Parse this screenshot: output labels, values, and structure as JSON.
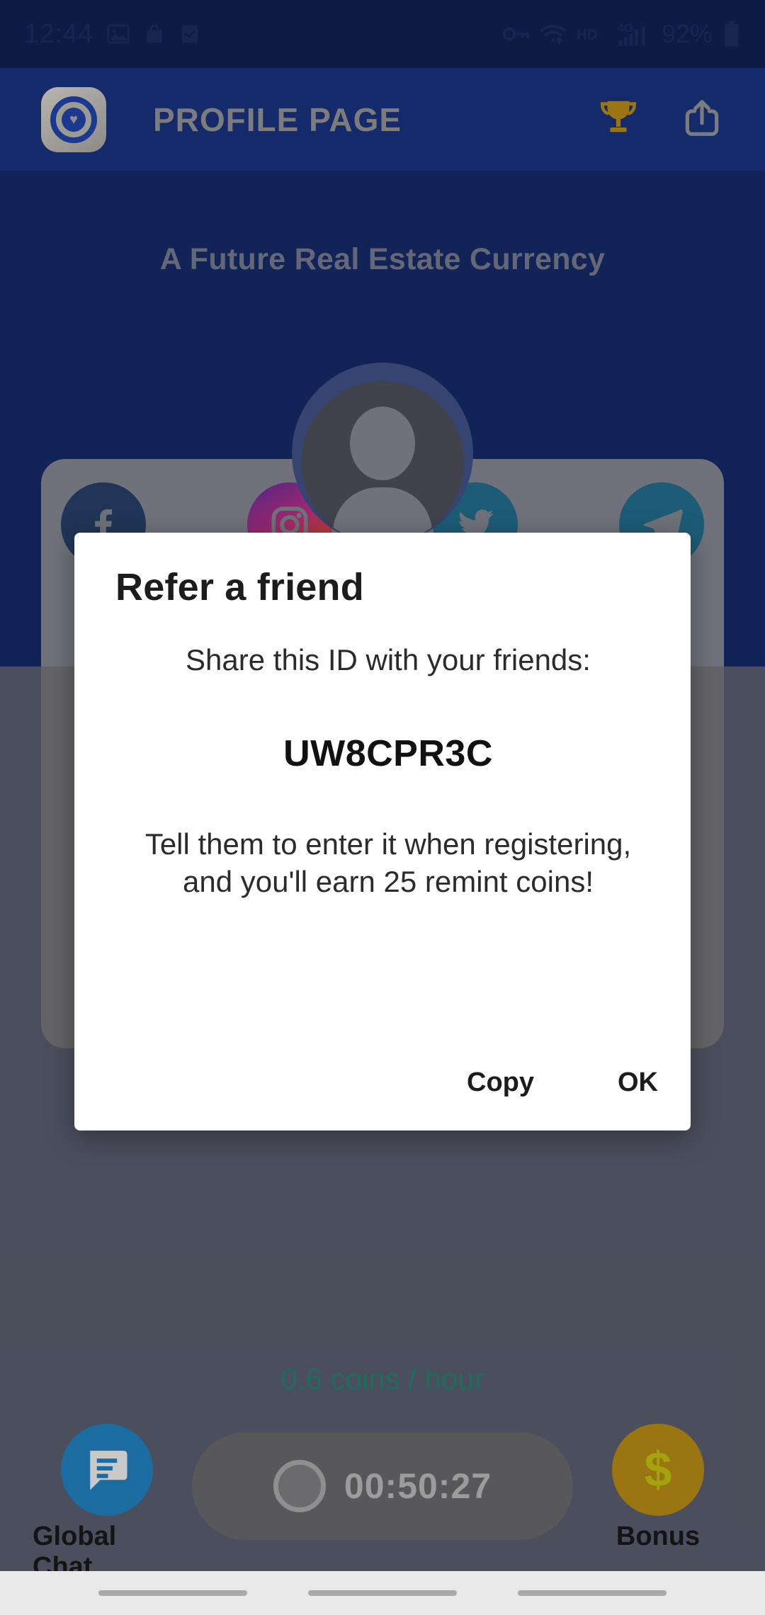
{
  "status_bar": {
    "time": "12:44",
    "left_icons": [
      "image-icon",
      "shopping-bag-icon",
      "checkbox-icon"
    ],
    "right_icons": [
      "vpn-key-icon",
      "wifi-icon",
      "hd-icon",
      "4g-signal-icon"
    ],
    "hd_label": "HD",
    "network_label": "4G",
    "battery_percent": "92%",
    "battery_icon": "battery-full-icon"
  },
  "app_bar": {
    "logo_icon": "app-logo-icon",
    "title": "PROFILE PAGE",
    "trophy_icon": "trophy-icon",
    "share_icon": "share-icon"
  },
  "page": {
    "tagline": "A Future Real Estate Currency",
    "avatar_icon": "avatar-placeholder-icon",
    "social": [
      {
        "name": "facebook-icon",
        "glyph": "f"
      },
      {
        "name": "instagram-icon",
        "glyph": ""
      },
      {
        "name": "twitter-icon",
        "glyph": ""
      },
      {
        "name": "telegram-icon",
        "glyph": ""
      }
    ]
  },
  "dialog": {
    "title": "Refer a friend",
    "subtitle": "Share this ID with your friends:",
    "referral_code": "UW8CPR3C",
    "body": "Tell them to enter it when registering, and you'll earn 25 remint coins!",
    "copy_label": "Copy",
    "ok_label": "OK"
  },
  "bottom": {
    "rate_text": "0.6 coins / hour",
    "chat_icon": "chat-bubble-icon",
    "chat_label": "Global Chat",
    "timer_icon": "record-circle-icon",
    "timer_value": "00:50:27",
    "bonus_icon": "dollar-sign-icon",
    "bonus_label": "Bonus"
  },
  "colors": {
    "status_bar_bg": "#0c1c45",
    "app_bar_bg": "#152a6b",
    "page_bg": "#12255e",
    "trophy_gold": "#9a7512",
    "rate_green": "#1d6d5c",
    "chat_blue": "#1b6ca0",
    "bonus_gold": "#9a7512",
    "dialog_bg": "#ffffff"
  }
}
